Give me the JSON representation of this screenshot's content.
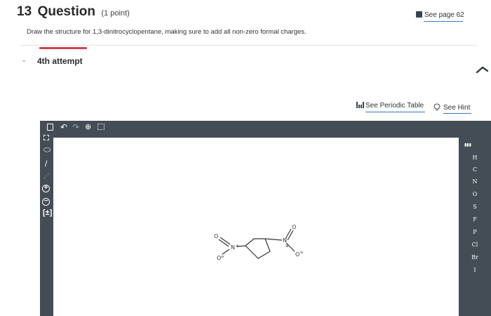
{
  "question": {
    "number": "13",
    "word": "Question",
    "points": "(1 point)",
    "text": "Draw the structure for 1,3-dinitrocyclopentane, making sure to add all non-zero formal charges."
  },
  "links": {
    "see_page": "See page 62",
    "periodic_table": "See Periodic Table",
    "hint": "See Hint"
  },
  "attempt": {
    "label": "4th attempt"
  },
  "toolbar": {
    "top_tools": [
      "new-document-icon",
      "undo-icon",
      "redo-icon",
      "zoom-icon",
      "template-icon"
    ],
    "left_tools": [
      "select-icon",
      "eraser-icon",
      "bond-icon",
      "chain-icon",
      "plus-charge-icon",
      "minus-charge-icon",
      "bracket-icon"
    ]
  },
  "elements_panel": {
    "symbols": [
      "H",
      "C",
      "N",
      "O",
      "S",
      "F",
      "P",
      "Cl",
      "Br",
      "I"
    ]
  },
  "molecule": {
    "atom_labels": {
      "left_o_top": "O",
      "left_o_bottom": "O",
      "left_n": "N",
      "right_o_top": "O",
      "right_o_bottom": "O",
      "right_n": "N",
      "plus": "⊕",
      "minus": "⊖"
    }
  },
  "colors": {
    "editor_bg": "#444c55",
    "accent_red": "#d0424e",
    "link_blue": "#3a78c9"
  }
}
